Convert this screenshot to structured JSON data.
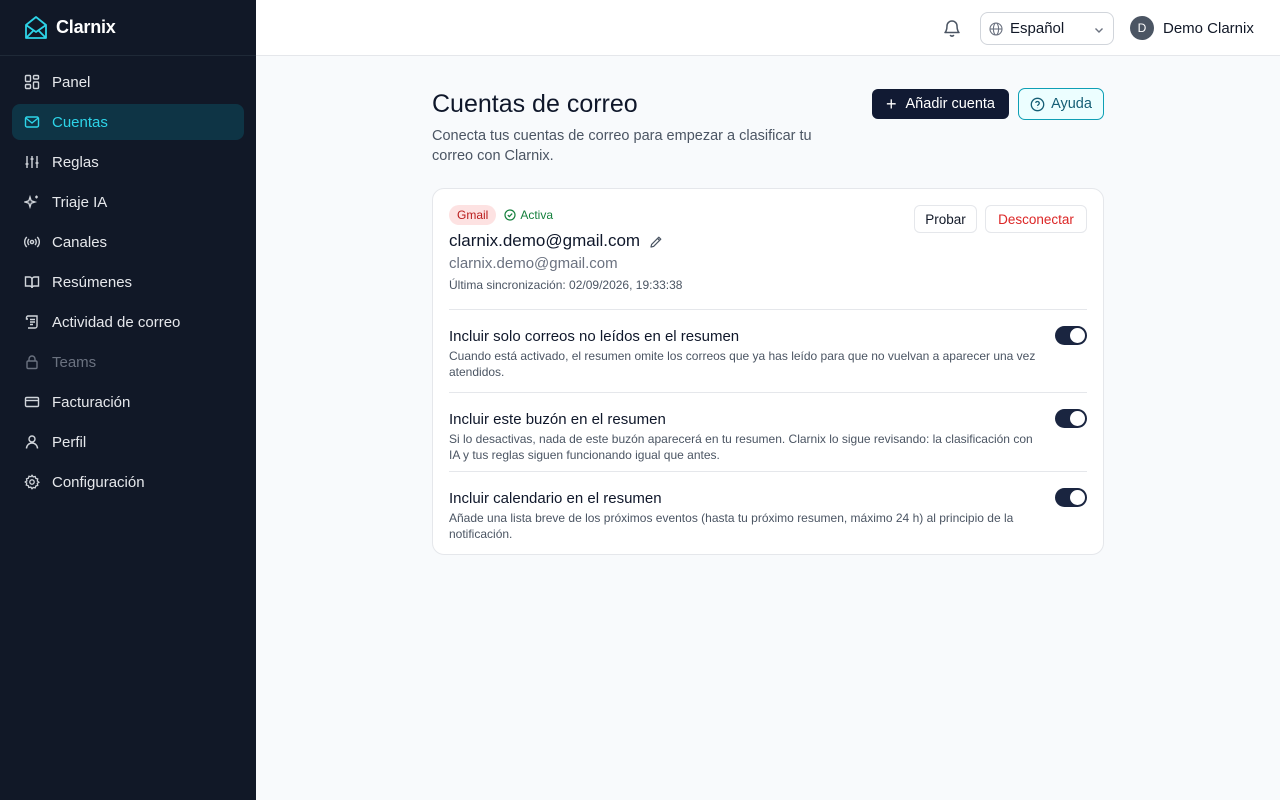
{
  "app": {
    "name": "Clarnix"
  },
  "sidebar": {
    "items": [
      {
        "label": "Panel",
        "icon": "grid-icon",
        "state": "normal"
      },
      {
        "label": "Cuentas",
        "icon": "mail-icon",
        "state": "active"
      },
      {
        "label": "Reglas",
        "icon": "sliders-icon",
        "state": "normal"
      },
      {
        "label": "Triaje IA",
        "icon": "sparkles-icon",
        "state": "normal"
      },
      {
        "label": "Canales",
        "icon": "broadcast-icon",
        "state": "normal"
      },
      {
        "label": "Resúmenes",
        "icon": "book-icon",
        "state": "normal"
      },
      {
        "label": "Actividad de correo",
        "icon": "scroll-icon",
        "state": "normal"
      },
      {
        "label": "Teams",
        "icon": "lock-icon",
        "state": "disabled"
      },
      {
        "label": "Facturación",
        "icon": "credit-card-icon",
        "state": "normal"
      },
      {
        "label": "Perfil",
        "icon": "user-icon",
        "state": "normal"
      },
      {
        "label": "Configuración",
        "icon": "gear-icon",
        "state": "normal"
      }
    ]
  },
  "topbar": {
    "language": "Español",
    "user_initial": "D",
    "user_name": "Demo Clarnix"
  },
  "main": {
    "title": "Cuentas de correo",
    "subtitle": "Conecta tus cuentas de correo para empezar a clasificar tu correo con Clarnix.",
    "add_account_label": "Añadir cuenta",
    "help_label": "Ayuda"
  },
  "account": {
    "provider": "Gmail",
    "status": "Activa",
    "display_name": "clarnix.demo@gmail.com",
    "email": "clarnix.demo@gmail.com",
    "last_sync": "Última sincronización: 02/09/2026, 19:33:38",
    "test_label": "Probar",
    "disconnect_label": "Desconectar",
    "settings": [
      {
        "title": "Incluir solo correos no leídos en el resumen",
        "description": "Cuando está activado, el resumen omite los correos que ya has leído para que no vuelvan a aparecer una vez atendidos.",
        "enabled": true
      },
      {
        "title": "Incluir este buzón en el resumen",
        "description": "Si lo desactivas, nada de este buzón aparecerá en tu resumen. Clarnix lo sigue revisando: la clasificación con IA y tus reglas siguen funcionando igual que antes.",
        "enabled": true
      },
      {
        "title": "Incluir calendario en el resumen",
        "description": "Añade una lista breve de los próximos eventos (hasta tu próximo resumen, máximo 24 h) al principio de la notificación.",
        "enabled": true
      }
    ]
  },
  "colors": {
    "sidebar_bg": "#111827",
    "accent": "#2dd4e8",
    "primary_button": "#111a33",
    "danger": "#dc2626",
    "success": "#15803d"
  }
}
